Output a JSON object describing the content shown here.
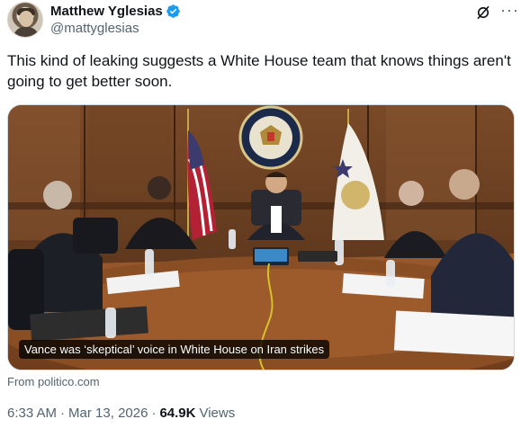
{
  "author": {
    "display_name": "Matthew Yglesias",
    "handle": "@mattyglesias",
    "verified_color": "#1d9bf0"
  },
  "icons": [
    "avatar",
    "verified-badge-icon",
    "grok-icon",
    "more-icon"
  ],
  "tweet": {
    "text": "This kind of leaking suggests a White House team that knows things aren't going to get better soon."
  },
  "card": {
    "caption": "Vance was ‘skeptical’ voice in White House on Iran strikes",
    "source": "From politico.com"
  },
  "meta": {
    "time": "6:33 AM",
    "separator": "·",
    "date": "Mar 13, 2026",
    "separator2": "·",
    "views_count": "64.9K",
    "views_label": "Views"
  }
}
